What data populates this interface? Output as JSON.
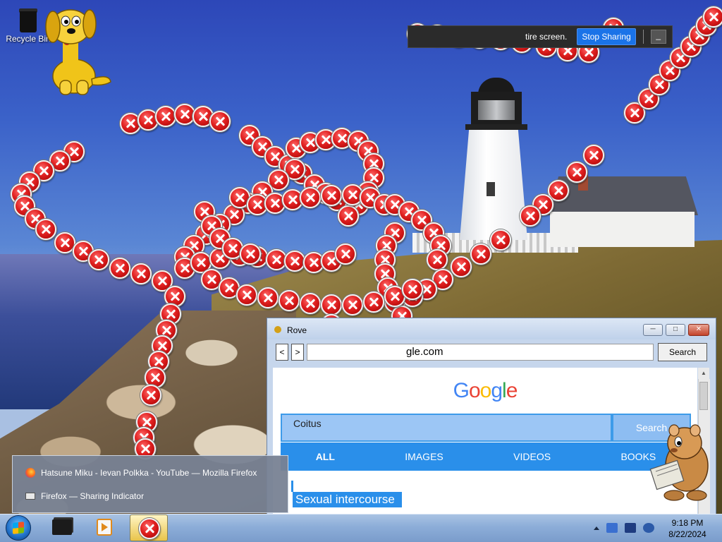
{
  "desktop": {
    "recycle_bin_label": "Recycle Bin"
  },
  "sharing_indicator": {
    "message": "tire screen.",
    "stop_label": "Stop Sharing",
    "minimize_label": "_"
  },
  "browser": {
    "title": "Rove",
    "back_label": "<",
    "forward_label": ">",
    "url": "gle.com",
    "search_button": "Search",
    "page": {
      "logo_letters": [
        {
          "ch": "G",
          "color": "#4285f4"
        },
        {
          "ch": "o",
          "color": "#ea4335"
        },
        {
          "ch": "o",
          "color": "#fbbc05"
        },
        {
          "ch": "g",
          "color": "#4285f4"
        },
        {
          "ch": "l",
          "color": "#34a853"
        },
        {
          "ch": "e",
          "color": "#ea4335"
        }
      ],
      "query": "Coitus",
      "search_label": "Search",
      "tabs": [
        "ALL",
        "IMAGES",
        "VIDEOS",
        "BOOKS"
      ],
      "active_tab": "ALL",
      "result_title": "Sexual intercourse"
    }
  },
  "jump_list": {
    "items": [
      {
        "label": "Hatsune Miku - Ievan Polkka - YouTube — Mozilla Firefox",
        "icon": "firefox-icon"
      },
      {
        "label": "Firefox — Sharing Indicator",
        "icon": "window-icon"
      }
    ]
  },
  "taskbar": {
    "time": "9:18 PM",
    "date": "8/22/2024"
  },
  "colors": {
    "error_red": "#e02020",
    "stop_sharing_blue": "#1a73e8",
    "google_tab_blue": "#2a8fea"
  }
}
